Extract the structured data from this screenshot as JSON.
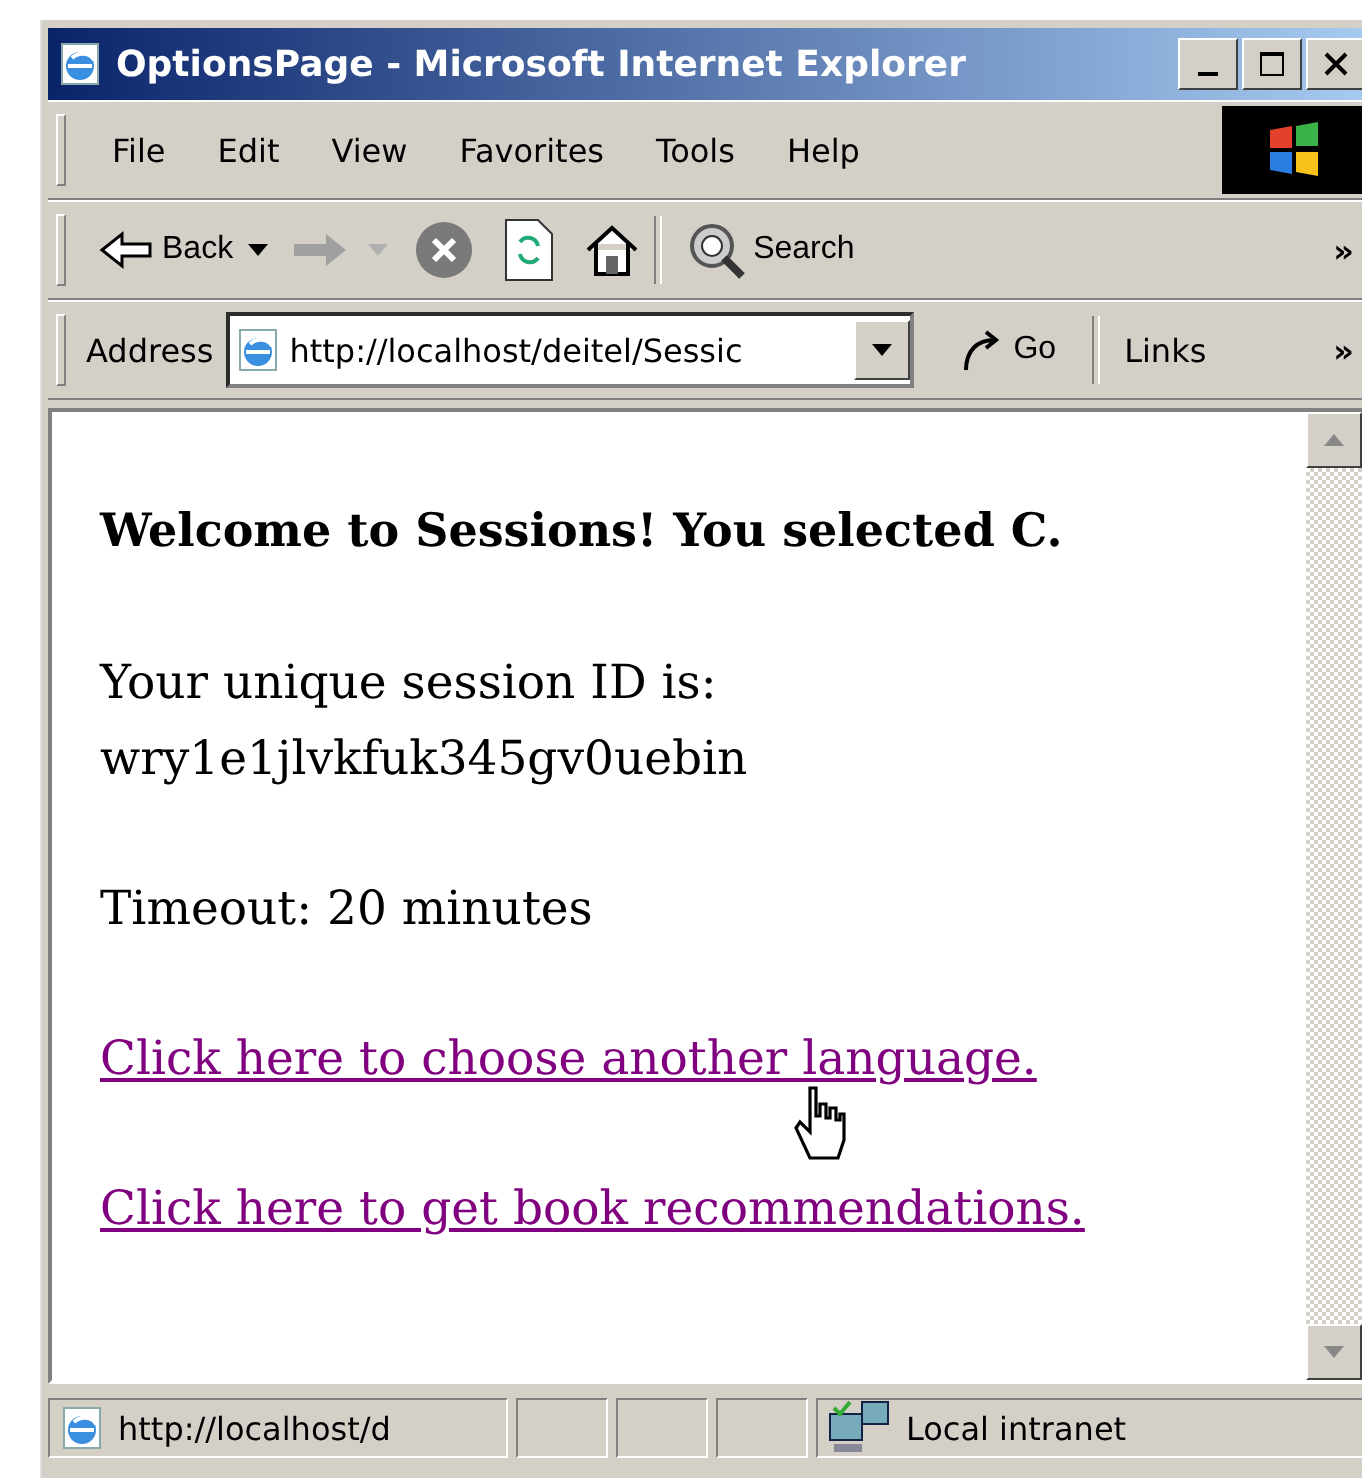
{
  "window": {
    "title": "OptionsPage - Microsoft Internet Explorer"
  },
  "menu": [
    {
      "label": "File"
    },
    {
      "label": "Edit"
    },
    {
      "label": "View"
    },
    {
      "label": "Favorites"
    },
    {
      "label": "Tools"
    },
    {
      "label": "Help"
    }
  ],
  "toolbar": {
    "back": "Back",
    "forward_disabled": true,
    "search": "Search",
    "more": "»"
  },
  "address_bar": {
    "label": "Address",
    "value": "http://localhost/deitel/Sessic",
    "go": "Go",
    "links": "Links",
    "more": "»"
  },
  "content": [
    {
      "kind": "heading",
      "lines": [
        "Welcome to Sessions! You selected C."
      ]
    },
    {
      "kind": "text",
      "lines": [
        "Your unique session ID is:",
        "wry1e1jlvkfuk345gv0uebin"
      ]
    },
    {
      "kind": "text",
      "lines": [
        "Timeout: 20 minutes"
      ]
    },
    {
      "kind": "link",
      "lines": [
        "Click here to choose another language."
      ]
    },
    {
      "kind": "link",
      "lines": [
        "Click here to get book recommendations."
      ]
    }
  ],
  "status_bar": {
    "url": "http://localhost/d",
    "zone": "Local intranet"
  }
}
